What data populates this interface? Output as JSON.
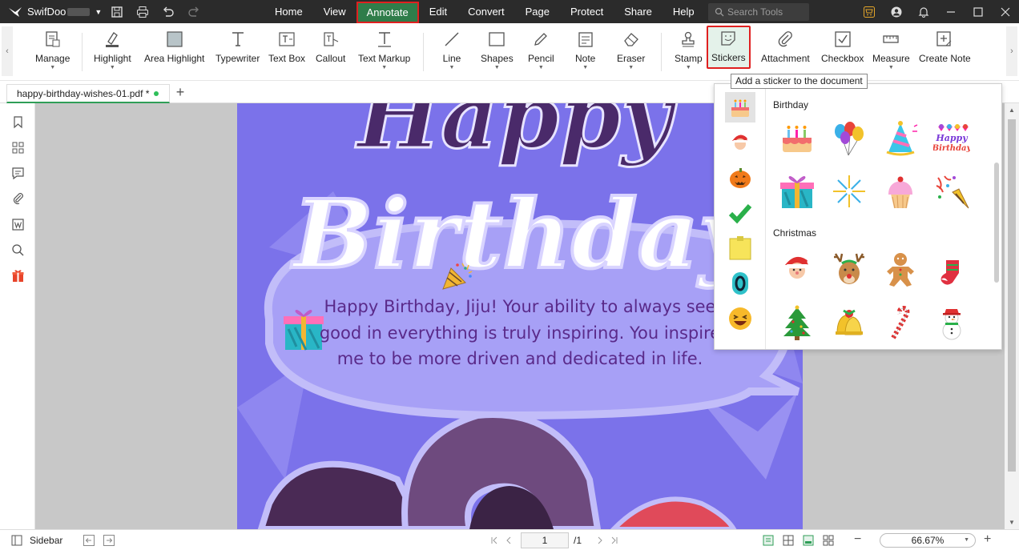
{
  "app": {
    "brand": "SwifDoo",
    "menus": [
      "Home",
      "View",
      "Annotate",
      "Edit",
      "Convert",
      "Page",
      "Protect",
      "Share",
      "Help"
    ],
    "active_menu": "Annotate",
    "search_placeholder": "Search Tools"
  },
  "ribbon": {
    "tools": [
      "Manage",
      "Highlight",
      "Area Highlight",
      "Typewriter",
      "Text Box",
      "Callout",
      "Text Markup",
      "Line",
      "Shapes",
      "Pencil",
      "Note",
      "Eraser",
      "Stamp",
      "Stickers",
      "Attachment",
      "Checkbox",
      "Measure",
      "Create Note"
    ],
    "selected_tool": "Stickers",
    "tooltip": "Add a sticker to the document"
  },
  "tab": {
    "filename": "happy-birthday-wishes-01.pdf *"
  },
  "document": {
    "title_line1": "Happy",
    "title_line2": "Birthday",
    "wishes": "Happy Birthday, Jiju! Your ability to always see good in everything is truly inspiring. You inspire me to be more driven and dedicated in life."
  },
  "stickers_panel": {
    "sections": [
      {
        "title": "Birthday",
        "items": [
          "birthday-cake",
          "balloons",
          "party-hat",
          "happy-birthday-cupcakes",
          "gift-box",
          "fireworks",
          "cupcake",
          "party-popper"
        ]
      },
      {
        "title": "Christmas",
        "items": [
          "santa",
          "reindeer",
          "gingerbread-man",
          "christmas-stocking",
          "christmas-tree",
          "bells",
          "candy-cane",
          "snowman"
        ]
      }
    ],
    "categories": [
      "birthday",
      "christmas",
      "halloween",
      "check",
      "sticky-note",
      "number",
      "emoji"
    ],
    "happy_birthday_sticker_text": [
      "Happy",
      "Birthday"
    ]
  },
  "statusbar": {
    "sidebar_label": "Sidebar",
    "current_page": "1",
    "total_pages": "/1",
    "zoom": "66.67%"
  },
  "colors": {
    "titlebar_bg": "#2b2b2b",
    "active_menu_bg": "#2f7d4a",
    "highlight_border": "#e02020",
    "page_bg": "#7b72ea",
    "wishes_text": "#5a2a8a"
  }
}
